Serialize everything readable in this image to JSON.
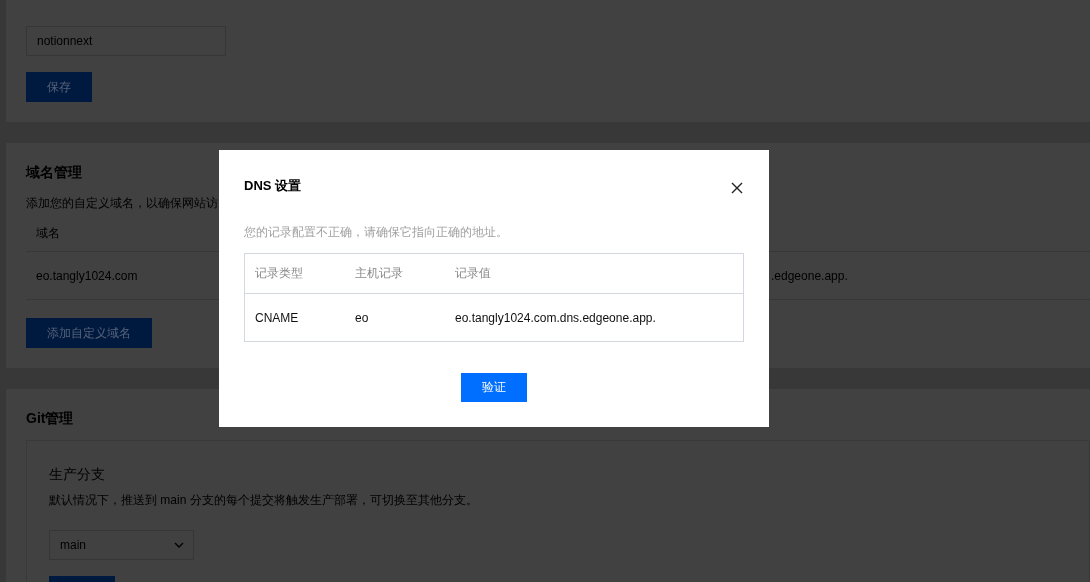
{
  "site_settings": {
    "field": {
      "value": "notionnext"
    },
    "save_button": "保存"
  },
  "domain_management": {
    "title": "域名管理",
    "description": "添加您的自定义域名，以确保网站访",
    "table": {
      "columns": [
        "域名"
      ],
      "rows": [
        {
          "cells": [
            "eo.tangly1024.com",
            ".edgeone.app."
          ]
        }
      ]
    },
    "add_button": "添加自定义域名"
  },
  "git_management": {
    "title": "Git管理",
    "production_branch": {
      "title": "生产分支",
      "description": "默认情况下，推送到 main 分支的每个提交将触发生产部署，可切换至其他分支。",
      "select": {
        "value": "main"
      }
    }
  },
  "dialog": {
    "title": "DNS 设置",
    "message": "您的记录配置不正确，请确保它指向正确的地址。",
    "table": {
      "columns": [
        "记录类型",
        "主机记录",
        "记录值"
      ],
      "rows": [
        {
          "cells": [
            "CNAME",
            "eo",
            "eo.tangly1024.com.dns.edgeone.app."
          ]
        }
      ]
    },
    "confirm_button": "验证"
  }
}
